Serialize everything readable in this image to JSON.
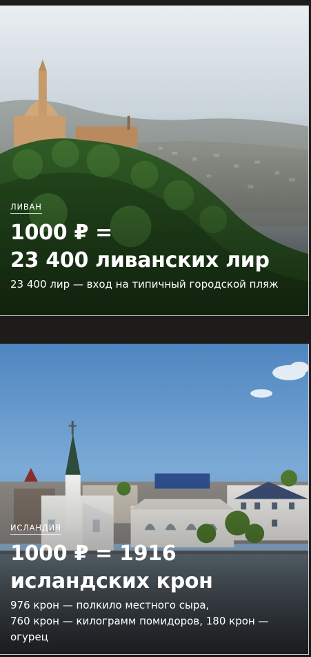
{
  "cards": [
    {
      "tag": "ЛИВАН",
      "headline_line1": "1000 ₽ =",
      "headline_line2": "23 400 ливанских лир",
      "description": "23 400 лир — вход на типичный городской пляж"
    },
    {
      "tag": "ИСЛАНДИЯ",
      "headline_line1": "1000 ₽ = 1916",
      "headline_line2": "исландских крон",
      "description_line1": "976 крон — полкило местного сыра,",
      "description_line2": "760 крон — килограмм помидоров, 180 крон — огурец"
    }
  ]
}
